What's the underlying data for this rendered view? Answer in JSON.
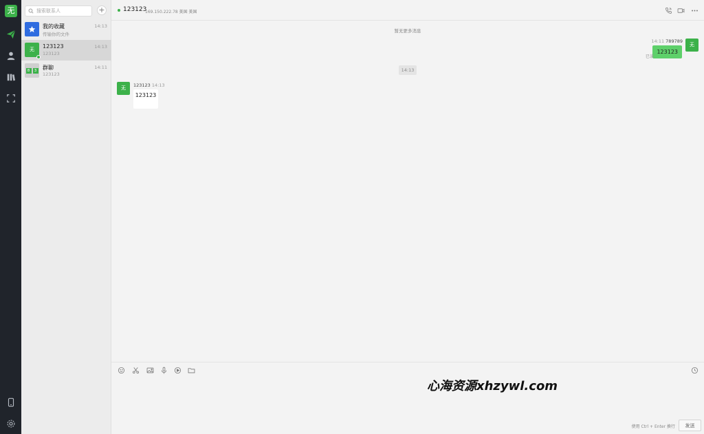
{
  "app": {
    "logo_text": "无"
  },
  "nav": {
    "items": [
      {
        "icon": "send-icon",
        "active": true
      },
      {
        "icon": "contacts-icon"
      },
      {
        "icon": "library-icon"
      },
      {
        "icon": "screenshot-icon"
      }
    ],
    "bottom": [
      {
        "icon": "phone-icon"
      },
      {
        "icon": "settings-icon"
      }
    ],
    "accent": "#3cb14a"
  },
  "search": {
    "placeholder": "搜索联系人"
  },
  "add_label": "+",
  "contacts": [
    {
      "name": "我的收藏",
      "sub": "传输你的文件",
      "time": "14:13",
      "avatar": "star-icon"
    },
    {
      "name": "123123",
      "sub": "123123",
      "time": "14:13",
      "avatar_text": "无",
      "online": true,
      "active": true
    },
    {
      "name": "群聊",
      "sub": "123123",
      "time": "14:11",
      "avatar_cells": [
        "8",
        "3"
      ]
    }
  ],
  "chat": {
    "title": "123123",
    "ip": "169.150.222.78 美国 美国",
    "no_more": "暂无更多消息",
    "messages": [
      {
        "side": "right",
        "time": "14:11",
        "sender": "789789",
        "text": "123123",
        "avatar_text": "无",
        "status": "已读"
      },
      {
        "separator": "14:13"
      },
      {
        "side": "left",
        "time": "14:13",
        "sender": "123123",
        "text": "123123",
        "avatar_text": "无"
      }
    ]
  },
  "composer": {
    "hint": "使用 Ctrl + Enter 换行",
    "send_label": "发送"
  },
  "watermark": "心海资源xhzywl.com"
}
